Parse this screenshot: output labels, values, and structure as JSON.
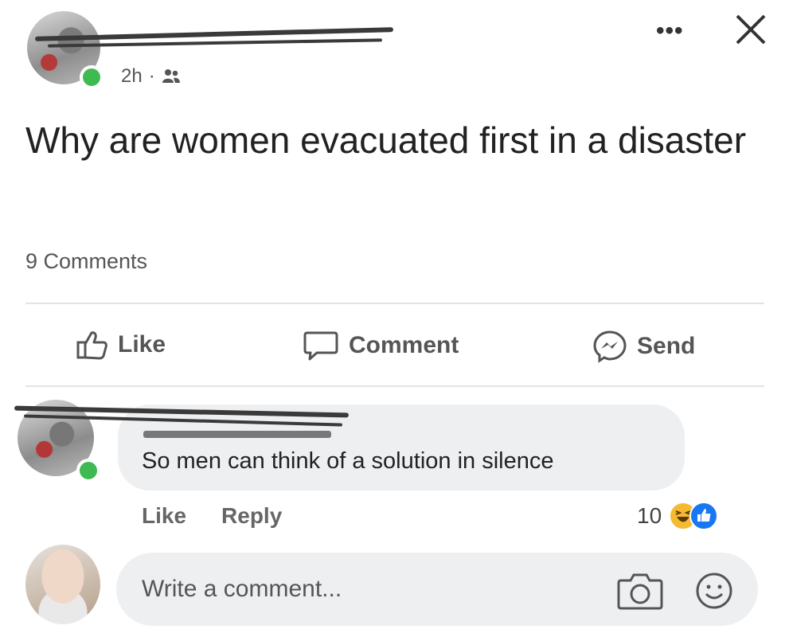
{
  "post": {
    "time": "2h",
    "separator": "·",
    "audience_icon": "friends-icon",
    "more_label": "•••",
    "text": "Why are women evacuated first in a disaster",
    "comment_count": "9 Comments"
  },
  "actions": {
    "like": "Like",
    "comment": "Comment",
    "send": "Send"
  },
  "comment": {
    "text": "So men can think of a solution in silence",
    "like": "Like",
    "reply": "Reply",
    "reaction_count": "10"
  },
  "composer": {
    "placeholder": "Write a comment..."
  },
  "colors": {
    "online": "#3fba53",
    "bubble": "#eeeff1",
    "haha": "#f5b932",
    "like_reaction": "#1877f2"
  }
}
